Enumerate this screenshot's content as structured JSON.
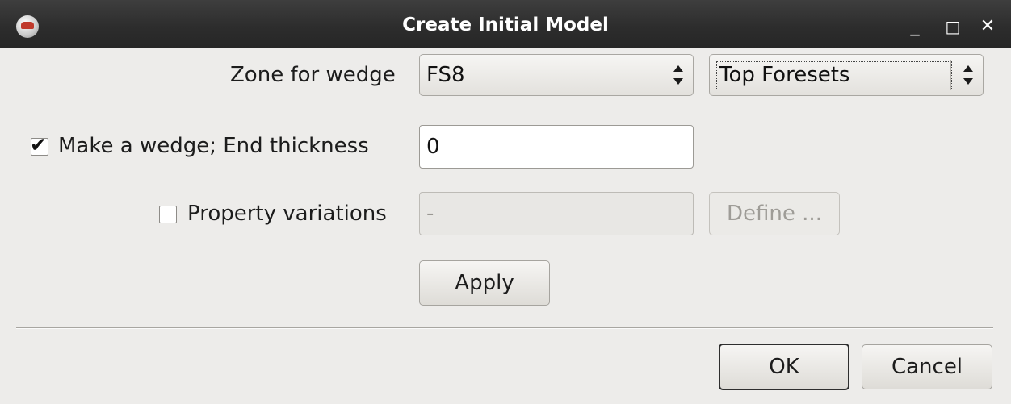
{
  "window": {
    "title": "Create Initial Model",
    "minimize_glyph": "_",
    "maximize_glyph": "□",
    "close_glyph": "✕"
  },
  "zone": {
    "label": "Zone for wedge",
    "zone_value": "FS8",
    "horizon_value": "Top Foresets"
  },
  "wedge": {
    "label": "Make a wedge; End thickness",
    "checked": true,
    "thickness_value": "0"
  },
  "property": {
    "label": "Property variations",
    "checked": false,
    "value": "-",
    "define_label": "Define ..."
  },
  "buttons": {
    "apply": "Apply",
    "ok": "OK",
    "cancel": "Cancel"
  },
  "icons": {
    "app": "app-icon",
    "dropdown": "updown-arrows-icon",
    "checkmark": "check-icon"
  }
}
